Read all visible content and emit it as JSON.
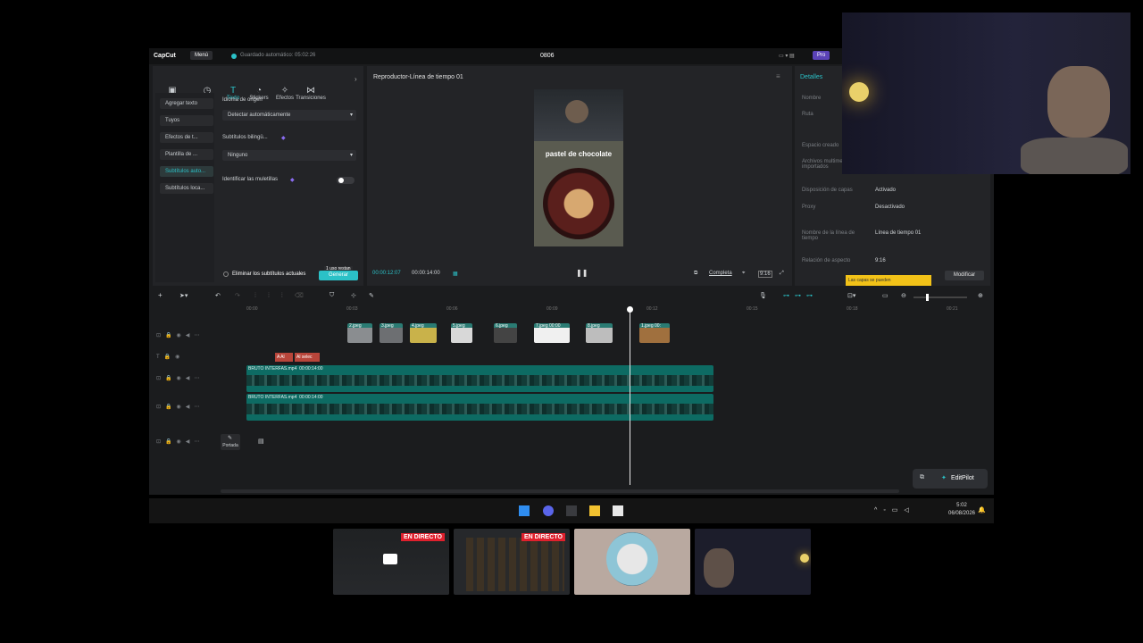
{
  "app": {
    "logo": "CapCut",
    "menu_label": "Menú",
    "autosave": "Guardado automático: 05:02:26",
    "project_title": "0806",
    "pro_label": "Pro"
  },
  "toolbar": {
    "items": [
      {
        "label": "Archivos multimedia",
        "icon": "media-icon"
      },
      {
        "label": "Audio",
        "icon": "audio-icon"
      },
      {
        "label": "Texto",
        "icon": "text-icon"
      },
      {
        "label": "Stickers",
        "icon": "sticker-icon"
      },
      {
        "label": "Efectos",
        "icon": "effects-icon"
      },
      {
        "label": "Transiciones",
        "icon": "transitions-icon"
      }
    ],
    "active_index": 2
  },
  "text_sidebar": {
    "items": [
      "Agregar texto",
      "Tuyos",
      "Efectos de t...",
      "Plantilla de ...",
      "Subtítulos auto...",
      "Subtítulos loca..."
    ],
    "active_index": 4
  },
  "subtitles": {
    "source_language_label": "Idioma de origen",
    "source_language_value": "Detectar automáticamente",
    "bilingual_label": "Subtítulos bilingü...",
    "bilingual_value": "Ninguno",
    "identify_label": "Identificar las muletillas",
    "remove_label": "Eliminar los subtítulos actuales",
    "uses_left": "1 uso restan",
    "generate_label": "Generar"
  },
  "player": {
    "title": "Reproductor-Línea de tiempo 01",
    "overlay_text": "pastel de chocolate",
    "time_current": "00:00:12:07",
    "time_total": "00:00:14:00",
    "quality_label": "Completa",
    "ratio_label": "9:16"
  },
  "details": {
    "tab": "Detalles",
    "rows": [
      {
        "key": "Nombre",
        "value": ""
      },
      {
        "key": "Ruta",
        "value": ""
      },
      {
        "key": "Espacio creado",
        "value": ""
      },
      {
        "key": "Archivos multimedia importados",
        "value": ""
      },
      {
        "key": "Disposición de capas",
        "value": "Activado"
      },
      {
        "key": "Proxy",
        "value": "Desactivado"
      },
      {
        "key": "Nombre de la línea de tiempo",
        "value": "Línea de tiempo 01"
      },
      {
        "key": "Relación de aspecto",
        "value": "9:16"
      }
    ],
    "notice": "Las capas se pueden",
    "modify_label": "Modificar"
  },
  "timeline": {
    "ruler": [
      "00:00",
      "00:03",
      "00:06",
      "00:09",
      "00:12",
      "00:15",
      "00:18",
      "00:21"
    ],
    "images": [
      "2.jpeg",
      "3.jpeg",
      "4.jpeg",
      "5.jpeg",
      "6.jpeg",
      "7.jpeg 00:00",
      "8.jpeg",
      "1.jpeg 00:"
    ],
    "text_clips": [
      "A Al",
      "Al selec"
    ],
    "video_tracks": [
      {
        "name": "BRUTO INTERFAS.mp4",
        "duration": "00:00:14:00"
      },
      {
        "name": "BRUTO INTERFAS.mp4",
        "duration": "00:00:14:00"
      }
    ],
    "cover_label": "Portada",
    "playhead_fraction": 0.82
  },
  "editpilot": {
    "label": "EditPilot"
  },
  "taskbar": {
    "time": "5:02",
    "date": "06/08/2026"
  },
  "stream_windows": [
    {
      "live": "EN DIRECTO"
    },
    {
      "live": "EN DIRECTO"
    },
    {
      "live": ""
    },
    {
      "live": ""
    }
  ],
  "colors": {
    "accent": "#2bc1c7",
    "track": "#0d6b63",
    "live": "#e0202d"
  }
}
